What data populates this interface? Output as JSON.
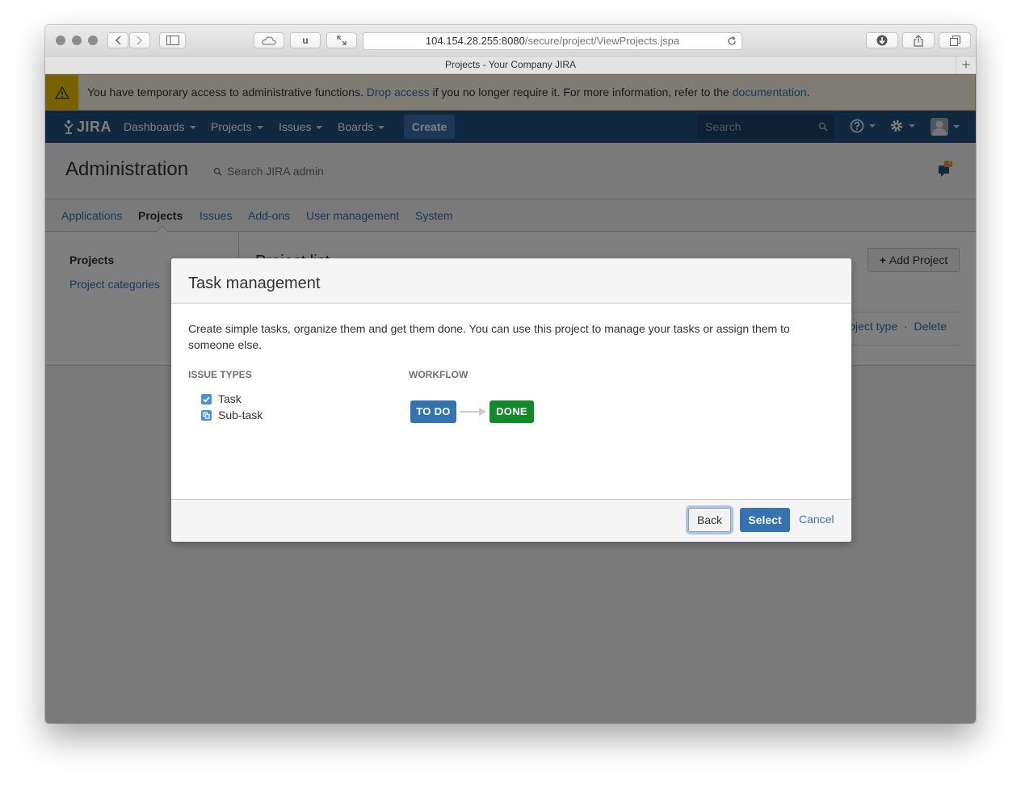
{
  "browser": {
    "url_host": "104.154.28.255:8080",
    "url_path": "/secure/project/ViewProjects.jspa",
    "tab_title": "Projects - Your Company JIRA",
    "tb_u_label": "u"
  },
  "banner": {
    "text_1": "You have temporary access to administrative functions. ",
    "link_1": "Drop access",
    "text_2": " if you no longer require it. For more information, refer to the ",
    "link_2": "documentation",
    "text_3": "."
  },
  "header": {
    "logo": "JIRA",
    "nav": [
      "Dashboards",
      "Projects",
      "Issues",
      "Boards"
    ],
    "create_label": "Create",
    "search_placeholder": "Search"
  },
  "admin": {
    "title": "Administration",
    "search_label": "Search JIRA admin",
    "feedback_badge": "!",
    "tabs": [
      "Applications",
      "Projects",
      "Issues",
      "Add-ons",
      "User management",
      "System"
    ],
    "active_tab": "Projects"
  },
  "sidebar": {
    "heading": "Projects",
    "link": "Project categories"
  },
  "main": {
    "title": "Project list",
    "add_project": "Add Project",
    "actions_1": "roject type",
    "actions_sep": "·",
    "actions_2": "Delete"
  },
  "dialog": {
    "title": "Task management",
    "description": "Create simple tasks, organize them and get them done. You can use this project to manage your tasks or assign them to someone else.",
    "issue_types_heading": "ISSUE TYPES",
    "issue_types": [
      "Task",
      "Sub-task"
    ],
    "workflow_heading": "WORKFLOW",
    "workflow": [
      "TO DO",
      "DONE"
    ],
    "back": "Back",
    "select": "Select",
    "cancel": "Cancel"
  },
  "colors": {
    "header": "#205081",
    "todo": "#3572b0",
    "done": "#14892c",
    "warning": "#f2c200"
  }
}
